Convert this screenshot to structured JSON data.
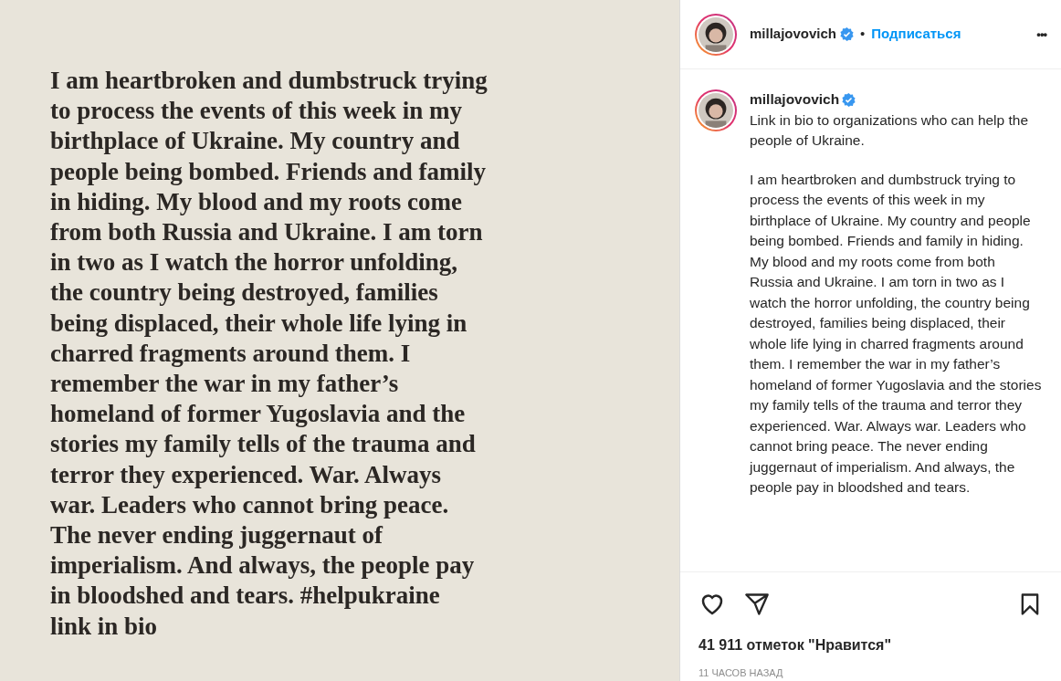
{
  "post_image": {
    "lines": [
      "I am heartbroken and dumbstruck trying",
      "to process the events of this week in my",
      "birthplace of Ukraine. My country and",
      "people being bombed. Friends and family",
      "in hiding. My blood and my roots come",
      "from both Russia and Ukraine. I am torn",
      "in two as I watch the horror unfolding,",
      "the country being destroyed, families",
      "being displaced, their whole life lying in",
      "charred fragments around them. I",
      "remember the war in my father’s",
      "homeland of former Yugoslavia and the",
      "stories my family tells of the trauma and",
      "terror they experienced. War. Always",
      "war. Leaders who cannot bring peace.",
      "The never ending juggernaut of",
      "imperialism. And always, the people pay",
      "in bloodshed and tears. #helpukraine",
      "link in bio"
    ]
  },
  "header": {
    "username": "millajovovich",
    "verified": true,
    "separator": "•",
    "follow": "Подписаться",
    "more": "•••"
  },
  "caption": {
    "username": "millajovovich",
    "verified": true,
    "paragraphs": [
      "Link in bio to organizations who can help the people of Ukraine.",
      "I am heartbroken and dumbstruck trying to process the events of this week in my birthplace of Ukraine. My country and people being bombed. Friends and family in hiding. My blood and my roots come from both Russia and Ukraine. I am torn in two as I watch the horror unfolding, the country being destroyed, families being displaced, their whole life lying in charred fragments around them. I remember the war in my father’s homeland of former Yugoslavia and the stories my family tells of the trauma and terror they experienced. War. Always war. Leaders who cannot bring peace. The never ending juggernaut of imperialism. And always, the people pay in bloodshed and tears."
    ]
  },
  "actions": {
    "liked": false,
    "saved": false
  },
  "likes": "41 911 отметок \"Нравится\"",
  "time": "11 ЧАСОВ НАЗАД"
}
